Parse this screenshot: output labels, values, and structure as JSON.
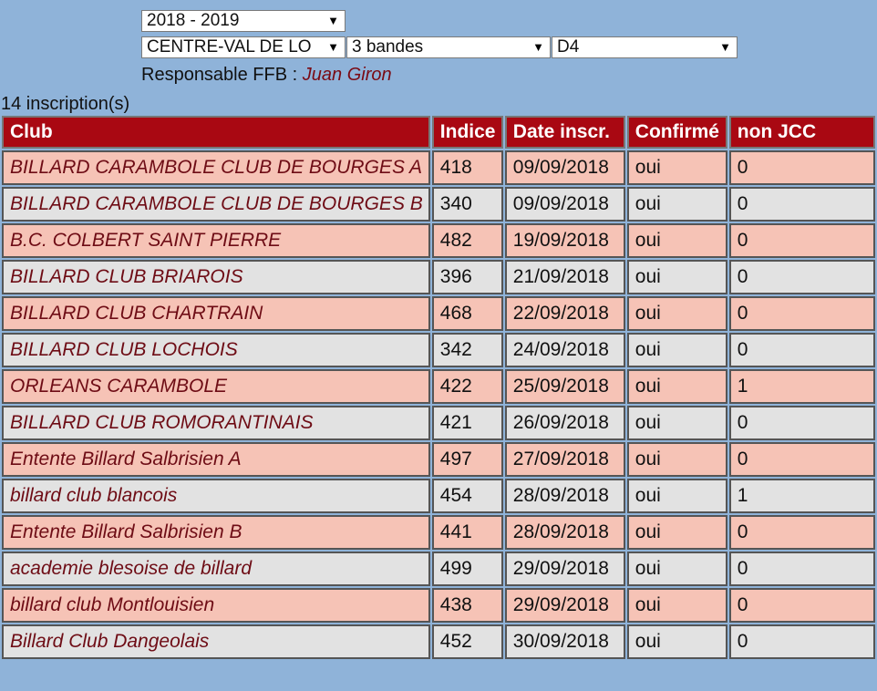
{
  "filters": {
    "season": "2018 - 2019",
    "region": "CENTRE-VAL DE LO",
    "game": "3 bandes",
    "division": "D4",
    "caret": "▼"
  },
  "responsable": {
    "label": "Responsable FFB :",
    "name": "Juan Giron"
  },
  "inscriptions_count": "14 inscription(s)",
  "table": {
    "headers": [
      "Club",
      "Indice",
      "Date inscr.",
      "Confirmé",
      "non JCC"
    ],
    "rows": [
      {
        "club": "BILLARD CARAMBOLE CLUB DE BOURGES A",
        "indice": "418",
        "date": "09/09/2018",
        "confirme": "oui",
        "non_jcc": "0"
      },
      {
        "club": "BILLARD CARAMBOLE CLUB DE BOURGES B",
        "indice": "340",
        "date": "09/09/2018",
        "confirme": "oui",
        "non_jcc": "0"
      },
      {
        "club": "B.C. COLBERT SAINT PIERRE",
        "indice": "482",
        "date": "19/09/2018",
        "confirme": "oui",
        "non_jcc": "0"
      },
      {
        "club": "BILLARD CLUB BRIAROIS",
        "indice": "396",
        "date": "21/09/2018",
        "confirme": "oui",
        "non_jcc": "0"
      },
      {
        "club": "BILLARD CLUB CHARTRAIN",
        "indice": "468",
        "date": "22/09/2018",
        "confirme": "oui",
        "non_jcc": "0"
      },
      {
        "club": "BILLARD CLUB LOCHOIS",
        "indice": "342",
        "date": "24/09/2018",
        "confirme": "oui",
        "non_jcc": "0"
      },
      {
        "club": "ORLEANS CARAMBOLE",
        "indice": "422",
        "date": "25/09/2018",
        "confirme": "oui",
        "non_jcc": "1"
      },
      {
        "club": "BILLARD CLUB ROMORANTINAIS",
        "indice": "421",
        "date": "26/09/2018",
        "confirme": "oui",
        "non_jcc": "0"
      },
      {
        "club": "Entente Billard Salbrisien A",
        "indice": "497",
        "date": "27/09/2018",
        "confirme": "oui",
        "non_jcc": "0"
      },
      {
        "club": "billard club blancois",
        "indice": "454",
        "date": "28/09/2018",
        "confirme": "oui",
        "non_jcc": "1"
      },
      {
        "club": "Entente Billard Salbrisien B",
        "indice": "441",
        "date": "28/09/2018",
        "confirme": "oui",
        "non_jcc": "0"
      },
      {
        "club": "academie blesoise de billard",
        "indice": "499",
        "date": "29/09/2018",
        "confirme": "oui",
        "non_jcc": "0"
      },
      {
        "club": "billard club Montlouisien",
        "indice": "438",
        "date": "29/09/2018",
        "confirme": "oui",
        "non_jcc": "0"
      },
      {
        "club": "Billard Club Dangeolais",
        "indice": "452",
        "date": "30/09/2018",
        "confirme": "oui",
        "non_jcc": "0"
      }
    ]
  },
  "colors": {
    "page_background": "#8fb3d9",
    "header_background": "#a90812",
    "row_odd": "#f6c3b6",
    "row_even": "#e2e2e2",
    "club_text": "#6e0c15"
  }
}
